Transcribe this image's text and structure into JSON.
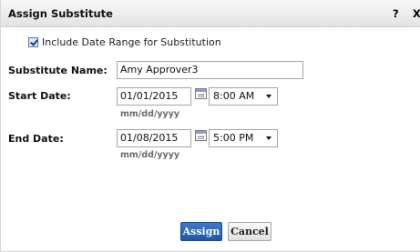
{
  "dialog": {
    "title": "Assign Substitute",
    "help_label": "?",
    "close_label": "X"
  },
  "date_range": {
    "checked": true,
    "label": "Include Date Range for Substitution"
  },
  "substitute": {
    "label": "Substitute Name:",
    "value": "Amy Approver3"
  },
  "start": {
    "label": "Start Date:",
    "date_value": "01/01/2015",
    "time_value": "8:00 AM",
    "hint": "mm/dd/yyyy"
  },
  "end": {
    "label": "End Date:",
    "date_value": "01/08/2015",
    "time_value": "5:00 PM",
    "hint": "mm/dd/yyyy"
  },
  "buttons": {
    "assign": "Assign",
    "cancel": "Cancel"
  },
  "colors": {
    "primary_button": "#2a63b5",
    "titlebar": "#ececec"
  }
}
